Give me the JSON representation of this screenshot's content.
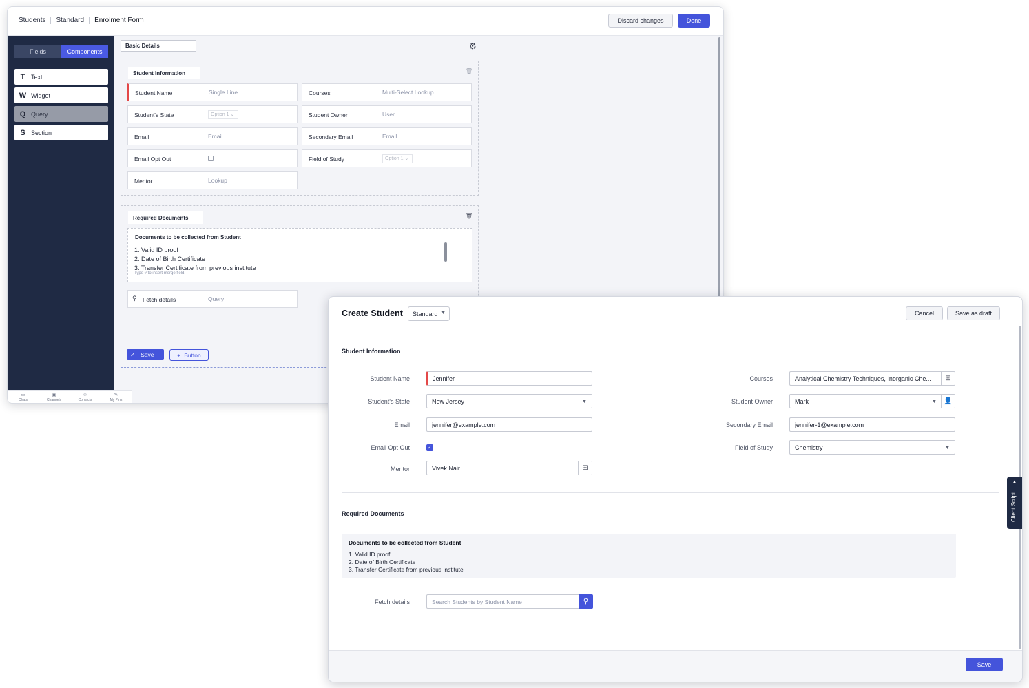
{
  "builder": {
    "breadcrumbs": [
      "Students",
      "Standard",
      "Enrolment Form"
    ],
    "discard_label": "Discard changes",
    "done_label": "Done",
    "tabs": {
      "fields": "Fields",
      "components": "Components"
    },
    "components": [
      {
        "glyph": "T",
        "label": "Text"
      },
      {
        "glyph": "W",
        "label": "Widget"
      },
      {
        "glyph": "Q",
        "label": "Query"
      },
      {
        "glyph": "S",
        "label": "Section"
      }
    ],
    "basic_tab": "Basic Details",
    "section1": {
      "title": "Student Information",
      "fields": {
        "student_name": {
          "label": "Student Name",
          "placeholder": "Single Line"
        },
        "courses": {
          "label": "Courses",
          "placeholder": "Multi-Select Lookup"
        },
        "state": {
          "label": "Student's State",
          "placeholder": "Option 1"
        },
        "owner": {
          "label": "Student Owner",
          "placeholder": "User"
        },
        "email": {
          "label": "Email",
          "placeholder": "Email"
        },
        "secondary_email": {
          "label": "Secondary Email",
          "placeholder": "Email"
        },
        "opt_out": {
          "label": "Email Opt Out"
        },
        "field_of_study": {
          "label": "Field of Study",
          "placeholder": "Option 1"
        },
        "mentor": {
          "label": "Mentor",
          "placeholder": "Lookup"
        }
      }
    },
    "section2": {
      "title": "Required Documents",
      "doc_title": "Documents to be collected from Student",
      "doc_lines": [
        "1. Valid ID proof",
        "2. Date of Birth Certificate",
        "3. Transfer Certificate from previous institute"
      ],
      "hint": "Type # to insert merge field.",
      "fetch_label": "Fetch details",
      "fetch_placeholder": "Query"
    },
    "save_label": "Save",
    "button_label": "Button",
    "bottom_nav": [
      "Chats",
      "Channels",
      "Contacts",
      "My Pins"
    ]
  },
  "create": {
    "title": "Create Student",
    "layout": "Standard",
    "cancel_label": "Cancel",
    "draft_label": "Save as draft",
    "section1_title": "Student Information",
    "fields": {
      "student_name": {
        "label": "Student Name",
        "value": "Jennifer"
      },
      "state": {
        "label": "Student's State",
        "value": "New Jersey"
      },
      "email": {
        "label": "Email",
        "value": "jennifer@example.com"
      },
      "opt_out": {
        "label": "Email Opt Out",
        "checked": true
      },
      "mentor": {
        "label": "Mentor",
        "value": "Vivek Nair"
      },
      "courses": {
        "label": "Courses",
        "value": "Analytical Chemistry Techniques, Inorganic Che..."
      },
      "owner": {
        "label": "Student Owner",
        "value": "Mark"
      },
      "secondary_email": {
        "label": "Secondary Email",
        "value": "jennifer-1@example.com"
      },
      "field_of_study": {
        "label": "Field of Study",
        "value": "Chemistry"
      }
    },
    "section2_title": "Required Documents",
    "doc_title": "Documents to be collected from Student",
    "doc_lines": [
      "1. Valid ID proof",
      "2. Date of Birth Certificate",
      "3. Transfer Certificate from previous institute"
    ],
    "fetch_label": "Fetch details",
    "fetch_placeholder": "Search Students by Student Name",
    "save_label": "Save",
    "client_script": "Client Script"
  },
  "colors": {
    "accent": "#4454db",
    "sidebar": "#1f2a44",
    "required": "#e34848"
  }
}
